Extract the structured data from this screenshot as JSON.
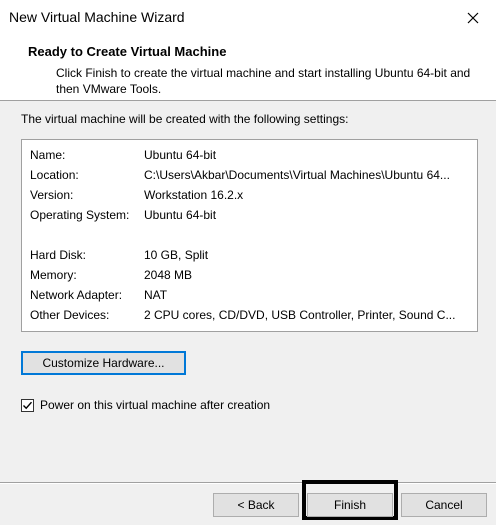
{
  "window": {
    "title": "New Virtual Machine Wizard",
    "close_icon": "close-icon"
  },
  "header": {
    "title": "Ready to Create Virtual Machine",
    "description": "Click Finish to create the virtual machine and start installing Ubuntu 64-bit and then VMware Tools."
  },
  "summary": {
    "intro": "The virtual machine will be created with the following settings:",
    "rows": [
      {
        "label": "Name:",
        "value": "Ubuntu 64-bit"
      },
      {
        "label": "Location:",
        "value": "C:\\Users\\Akbar\\Documents\\Virtual Machines\\Ubuntu 64..."
      },
      {
        "label": "Version:",
        "value": "Workstation 16.2.x"
      },
      {
        "label": "Operating System:",
        "value": "Ubuntu 64-bit"
      },
      {
        "label": "Hard Disk:",
        "value": "10 GB, Split"
      },
      {
        "label": "Memory:",
        "value": "2048 MB"
      },
      {
        "label": "Network Adapter:",
        "value": "NAT"
      },
      {
        "label": "Other Devices:",
        "value": "2 CPU cores, CD/DVD, USB Controller, Printer, Sound C..."
      }
    ]
  },
  "customize_button": "Customize Hardware...",
  "power_on": {
    "label": "Power on this virtual machine after creation",
    "checked": true
  },
  "footer": {
    "back": "< Back",
    "finish": "Finish",
    "cancel": "Cancel"
  }
}
